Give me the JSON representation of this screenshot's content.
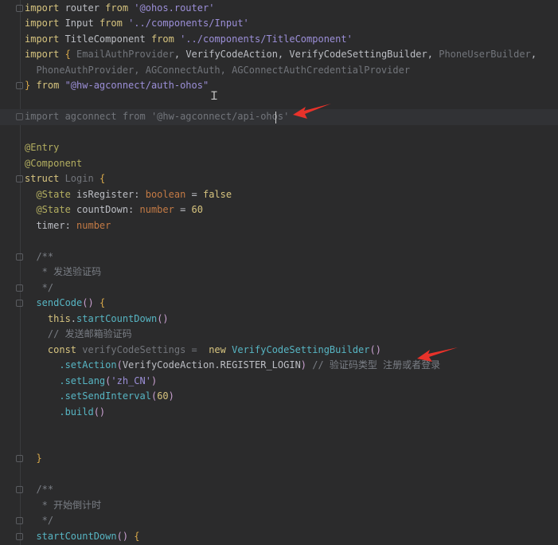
{
  "editor": {
    "highlighted_line": 7,
    "colors": {
      "background": "#2b2b2c",
      "keyword": "#d7c47f",
      "string": "#9c8fd8",
      "function": "#57b5c3",
      "annotation": "#b3ae60",
      "comment": "#7a7e85",
      "arrow": "#e8322a"
    },
    "lines": [
      [
        [
          "import",
          "kw"
        ],
        [
          " router ",
          "id"
        ],
        [
          "from",
          "kw"
        ],
        [
          " '@ohos.router'",
          "str"
        ]
      ],
      [
        [
          "import",
          "kw"
        ],
        [
          " Input ",
          "id"
        ],
        [
          "from",
          "kw"
        ],
        [
          " '../components/Input'",
          "str"
        ]
      ],
      [
        [
          "import",
          "kw"
        ],
        [
          " TitleComponent ",
          "id"
        ],
        [
          "from",
          "kw"
        ],
        [
          " '../components/TitleComponent'",
          "str"
        ]
      ],
      [
        [
          "import",
          "kw"
        ],
        [
          " ",
          "id"
        ],
        [
          "{",
          "br"
        ],
        [
          " EmailAuthProvider",
          "dim"
        ],
        [
          ", VerifyCodeAction, VerifyCodeSettingBuilder, ",
          "id"
        ],
        [
          "PhoneUserBuilder",
          "dim"
        ],
        [
          ",",
          "id"
        ]
      ],
      [
        [
          "  PhoneAuthProvider, AGConnectAuth, AGConnectAuthCredentialProvider",
          "dim"
        ]
      ],
      [
        [
          "}",
          "br"
        ],
        [
          " from",
          "kw"
        ],
        [
          " \"@hw-agconnect/auth-ohos\"",
          "str"
        ]
      ],
      [],
      [
        [
          "import agconnect from '@hw-agconnect/api-ohos'",
          "dim"
        ]
      ],
      [],
      [
        [
          "@Entry",
          "ann"
        ]
      ],
      [
        [
          "@Component",
          "ann"
        ]
      ],
      [
        [
          "struct",
          "kw"
        ],
        [
          " Login ",
          "dim"
        ],
        [
          "{",
          "br"
        ]
      ],
      [
        [
          "  @State",
          "ann"
        ],
        [
          " isRegister: ",
          "id"
        ],
        [
          "boolean",
          "type"
        ],
        [
          " = ",
          "id"
        ],
        [
          "false",
          "kw"
        ]
      ],
      [
        [
          "  @State",
          "ann"
        ],
        [
          " countDown: ",
          "id"
        ],
        [
          "number",
          "type"
        ],
        [
          " = ",
          "id"
        ],
        [
          "60",
          "num"
        ]
      ],
      [
        [
          "  timer: ",
          "id"
        ],
        [
          "number",
          "type"
        ]
      ],
      [],
      [
        [
          "  /**",
          "cm"
        ]
      ],
      [
        [
          "   * 发送验证码",
          "cm"
        ]
      ],
      [
        [
          "   */",
          "cm"
        ]
      ],
      [
        [
          "  sendCode",
          "fn"
        ],
        [
          "()",
          "pn"
        ],
        [
          " ",
          "id"
        ],
        [
          "{",
          "br"
        ]
      ],
      [
        [
          "    this",
          "kw"
        ],
        [
          ".",
          "id"
        ],
        [
          "startCountDown",
          "fn"
        ],
        [
          "()",
          "pn"
        ]
      ],
      [
        [
          "    // 发送邮箱验证码",
          "cm"
        ]
      ],
      [
        [
          "    const",
          "kw"
        ],
        [
          " verifyCodeSettings = ",
          "dim"
        ],
        [
          " new",
          "kw"
        ],
        [
          " VerifyCodeSettingBuilder",
          "fn"
        ],
        [
          "()",
          "pn"
        ]
      ],
      [
        [
          "      .setAction",
          "fn"
        ],
        [
          "(",
          "pn"
        ],
        [
          "VerifyCodeAction.REGISTER_LOGIN",
          "id"
        ],
        [
          ")",
          "pn"
        ],
        [
          " // 验证码类型 注册或者登录",
          "cm"
        ]
      ],
      [
        [
          "      .setLang",
          "fn"
        ],
        [
          "(",
          "pn"
        ],
        [
          "'zh_CN'",
          "str"
        ],
        [
          ")",
          "pn"
        ]
      ],
      [
        [
          "      .setSendInterval",
          "fn"
        ],
        [
          "(",
          "pn"
        ],
        [
          "60",
          "num"
        ],
        [
          ")",
          "pn"
        ]
      ],
      [
        [
          "      .build",
          "fn"
        ],
        [
          "()",
          "pn"
        ]
      ],
      [],
      [],
      [
        [
          "  }",
          "br"
        ]
      ],
      [],
      [
        [
          "  /**",
          "cm"
        ]
      ],
      [
        [
          "   * 开始倒计时",
          "cm"
        ]
      ],
      [
        [
          "   */",
          "cm"
        ]
      ],
      [
        [
          "  startCountDown",
          "fn"
        ],
        [
          "()",
          "pn"
        ],
        [
          " ",
          "id"
        ],
        [
          "{",
          "br"
        ]
      ]
    ],
    "fold_lines": [
      0,
      5,
      7,
      11,
      16,
      18,
      19,
      29,
      31,
      33,
      34
    ]
  }
}
